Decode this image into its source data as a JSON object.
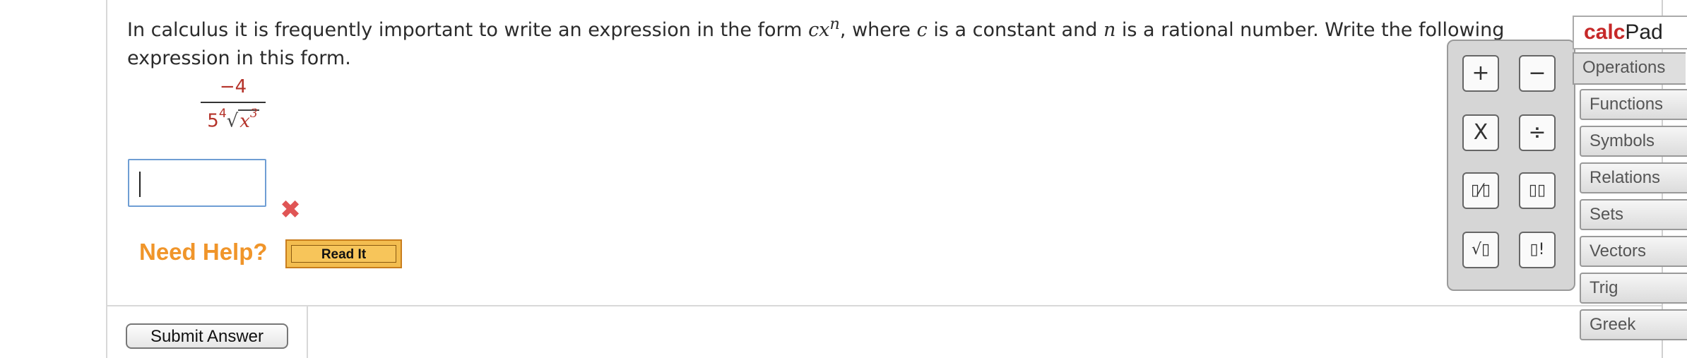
{
  "question": {
    "text_a": "In calculus it is frequently important to write an expression in the form ",
    "cx": "cx",
    "n_sup": "n",
    "text_b": ", where ",
    "c": "c",
    "text_c": " is a constant and ",
    "n": "n",
    "text_d": " is a rational number. Write the following expression in this form."
  },
  "expression": {
    "numerator": "−4",
    "coef": "5",
    "root_index": "4",
    "radicand": "x",
    "radicand_exp": "3"
  },
  "answer": {
    "value": ""
  },
  "feedback": {
    "wrong_symbol": "✖"
  },
  "help": {
    "label": "Need Help?",
    "read_it": "Read It"
  },
  "submit": {
    "label": "Submit Answer"
  },
  "calcpad": {
    "title_a": "calc",
    "title_b": "Pad",
    "buttons": [
      {
        "name": "plus",
        "label": "+"
      },
      {
        "name": "minus",
        "label": "−"
      },
      {
        "name": "times",
        "label": "X"
      },
      {
        "name": "divide",
        "label": "÷"
      },
      {
        "name": "fraction",
        "label": "▯⁄▯"
      },
      {
        "name": "power",
        "label": "▯▯"
      },
      {
        "name": "sqrt",
        "label": "√▯"
      },
      {
        "name": "factorial",
        "label": "▯!"
      }
    ],
    "categories": [
      "Operations",
      "Functions",
      "Symbols",
      "Relations",
      "Sets",
      "Vectors",
      "Trig",
      "Greek"
    ]
  }
}
